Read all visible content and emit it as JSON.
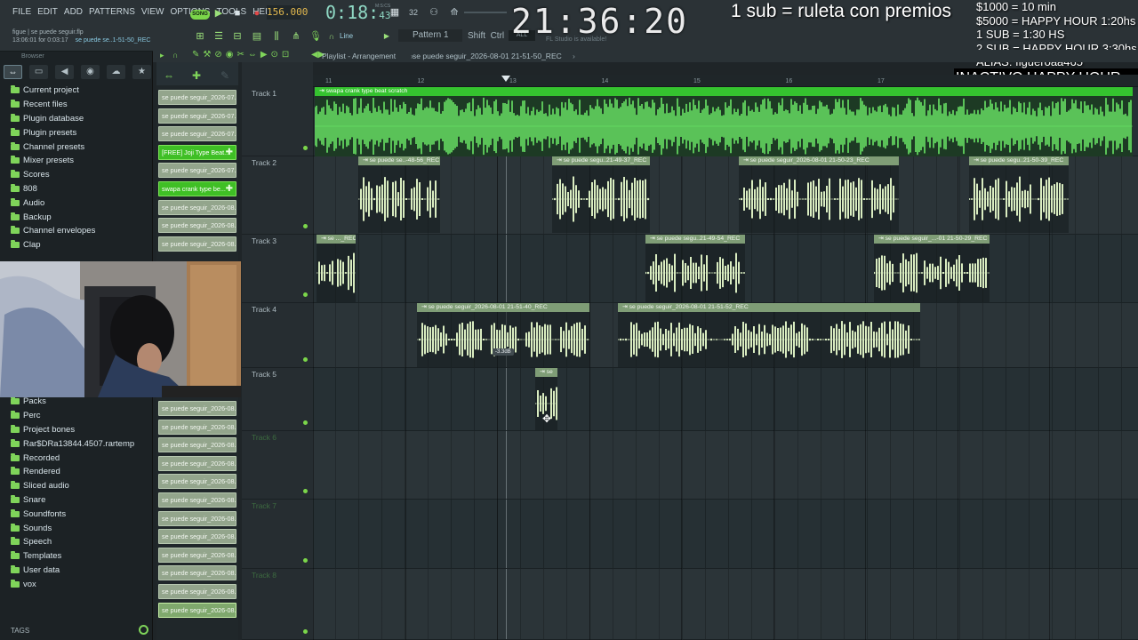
{
  "menu": [
    "FILE",
    "EDIT",
    "ADD",
    "PATTERNS",
    "VIEW",
    "OPTIONS",
    "TOOLS",
    "HELP"
  ],
  "transport": {
    "mode_badge": "SONG",
    "tempo": "156.000",
    "time_main": "0:18:",
    "time_sub": "43",
    "time_unit": "M:S:CS"
  },
  "project": {
    "user": "figue",
    "file": "se puede seguir.flp",
    "timer_line": "13:06:01 for 0:03:17",
    "recorded_name": "se puede se..1-51-50_REC"
  },
  "toolbar": {
    "line_label": "Line",
    "pattern_label": "Pattern 1",
    "shift_label": "Shift",
    "ctrl_label": "Ctrl",
    "studio_msg": "FL Studio is available!"
  },
  "stream_overlay": {
    "clock": "21:36:20",
    "title": "1 sub = ruleta con premios",
    "rules": [
      "$1000 = 10 min",
      "$5000 = HAPPY HOUR 1:20hs",
      "1 SUB = 1:30 HS",
      "2 SUB = HAPPY HOUR 3:30hs",
      "ALIAS: figueroaa465"
    ],
    "happy_hour": "INACTIVO HAPPY HOUR"
  },
  "browser": {
    "title": "Browser",
    "tabs": [
      "all-icon",
      "files-icon",
      "speaker-icon",
      "globe-icon",
      "cloud-icon",
      "star-icon"
    ],
    "items_top": [
      "Current project",
      "Recent files",
      "Plugin database",
      "Plugin presets",
      "Channel presets",
      "Mixer presets",
      "Scores",
      "808",
      "Audio",
      "Backup",
      "Channel envelopes",
      "Clap"
    ],
    "items_bottom": [
      "Packs",
      "Perc",
      "Project bones",
      "Rar$DRa13844.4507.rartemp",
      "Recorded",
      "Rendered",
      "Sliced audio",
      "Snare",
      "Soundfonts",
      "Sounds",
      "Speech",
      "Templates",
      "User data",
      "vox"
    ],
    "tags_label": "TAGS"
  },
  "channels": {
    "top": [
      "se puede seguir_2026-07...",
      "se puede seguir_2026-07...",
      "se puede seguir_2026-07...",
      "[FREE] Joji Type Beat...",
      "se puede seguir_2026-07...",
      "swapa crank type be...",
      "se puede seguir_2026-08...",
      "se puede seguir_2026-08...",
      "se puede seguir_2026-08..."
    ],
    "bottom": [
      "se puede seguir_2026-08...",
      "se puede seguir_2026-08...",
      "se puede seguir_2026-08...",
      "se puede seguir_2026-08...",
      "se puede seguir_2026-08...",
      "se puede seguir_2026-08...",
      "se puede seguir_2026-08...",
      "se puede seguir_2026-08...",
      "se puede seguir_2026-08...",
      "se puede seguir_2026-08...",
      "se puede seguir_2026-08...",
      "se puede seguir_2026-08..."
    ]
  },
  "playlist": {
    "title": "Playlist - Arrangement",
    "breadcrumb": "se puede seguir_2026-08-01 21-51-50_REC",
    "ruler": [
      "11",
      "12",
      "13",
      "14",
      "15",
      "16",
      "17"
    ],
    "tracks": [
      "Track 1",
      "Track 2",
      "Track 3",
      "Track 4",
      "Track 5",
      "Track 6",
      "Track 7",
      "Track 8"
    ],
    "clips": {
      "t1": "swapa  crank type beat scratch",
      "t2a": "se puede se..-48-56_REC",
      "t2b": "se puede segu..21-49-37_REC",
      "t2c": "se puede seguir_2026-08-01 21-50-23_REC",
      "t2d": "se puede segu..21-50-39_REC",
      "t3a": "se ..._REC",
      "t3b": "se puede segu..21-49-54_REC",
      "t3c": "se puede seguir_...-01 21-50-29_REC",
      "t4a": "se puede seguir_2026-08-01 21-51-40_REC",
      "t4b": "se puede seguir_2026-08-01 21-51-52_REC",
      "t5a": "se"
    },
    "gain_tag": "-3.3dB"
  },
  "colors": {
    "accent": "#7bd64a",
    "clip_header": "#7f9d76",
    "wave": "#d9ecc0",
    "beat_wave": "#6ff06a"
  }
}
